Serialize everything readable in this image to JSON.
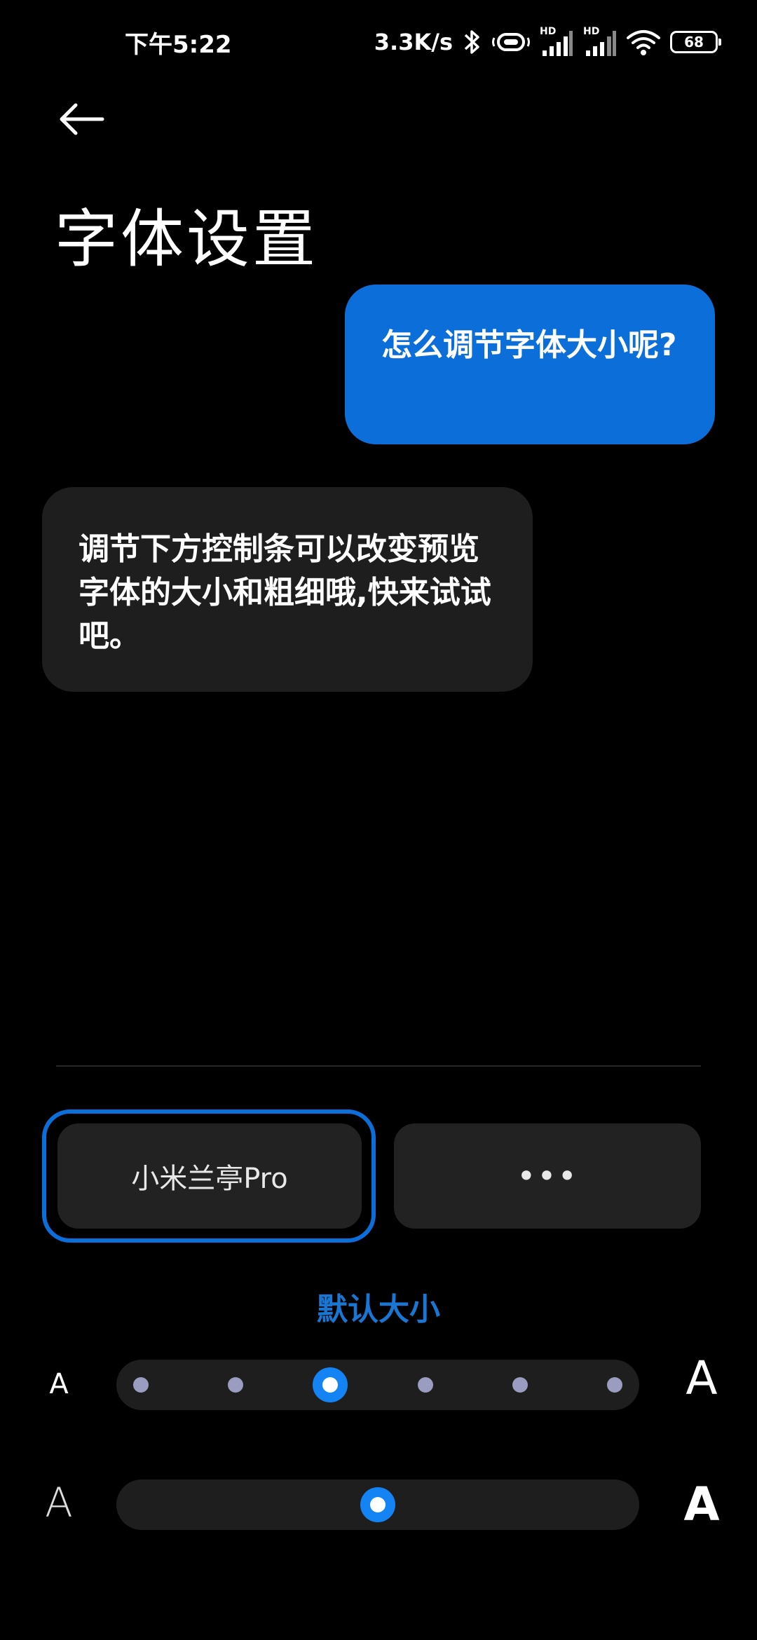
{
  "status_bar": {
    "time": "下午5:22",
    "net_speed": "3.3K/s",
    "battery": "68",
    "signal_tag_1": "HD",
    "signal_tag_2": "HD"
  },
  "header": {
    "title": "字体设置"
  },
  "chat": {
    "question": "怎么调节字体大小呢?",
    "answer": "调节下方控制条可以改变预览字体的大小和粗细哦,快来试试吧。"
  },
  "font_options": {
    "selected": "小米兰亭Pro",
    "more": "•••"
  },
  "size_slider": {
    "label": "默认大小",
    "min_label": "A",
    "max_label": "A",
    "steps": 6,
    "selected_index": 2
  },
  "weight_slider": {
    "min_label": "A",
    "max_label": "A",
    "value_fraction": 0.5
  },
  "colors": {
    "accent": "#1484f5",
    "bubble_question": "#0c6ed9",
    "bubble_answer": "#1e1e1e",
    "background": "#000000"
  }
}
